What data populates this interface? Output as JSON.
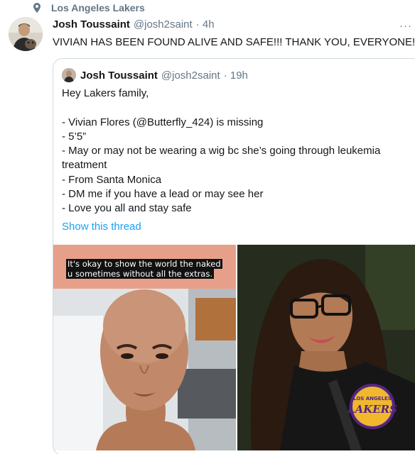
{
  "context": {
    "icon": "location-pin-icon",
    "label": "Los Angeles Lakers"
  },
  "tweet": {
    "name": "Josh Toussaint",
    "handle": "@josh2saint",
    "time": "· 4h",
    "text": "VIVIAN HAS BEEN FOUND ALIVE AND SAFE!!! THANK YOU, EVERYONE!!!",
    "more": "···"
  },
  "quote": {
    "name": "Josh Toussaint",
    "handle": "@josh2saint",
    "time": "· 19h",
    "lines": [
      "Hey Lakers family,",
      "",
      "- Vivian Flores (@Butterfly_424) is missing",
      "- 5’5”",
      "- May or may not be wearing a wig bc she’s going through leukemia",
      "treatment",
      "- From Santa Monica",
      "- DM me if you have a lead or may see her",
      "- Love you all and stay safe"
    ],
    "show_thread": "Show this thread",
    "image_caption_1": "It's okay to show the world the naked",
    "image_caption_2": "u sometimes without all the extras.",
    "jacket_logo_top": "LOS ANGELES",
    "jacket_logo_main": "LAKERS"
  },
  "colors": {
    "link": "#1da1f2",
    "secondary_text": "#657786",
    "border": "#cfd9de"
  }
}
